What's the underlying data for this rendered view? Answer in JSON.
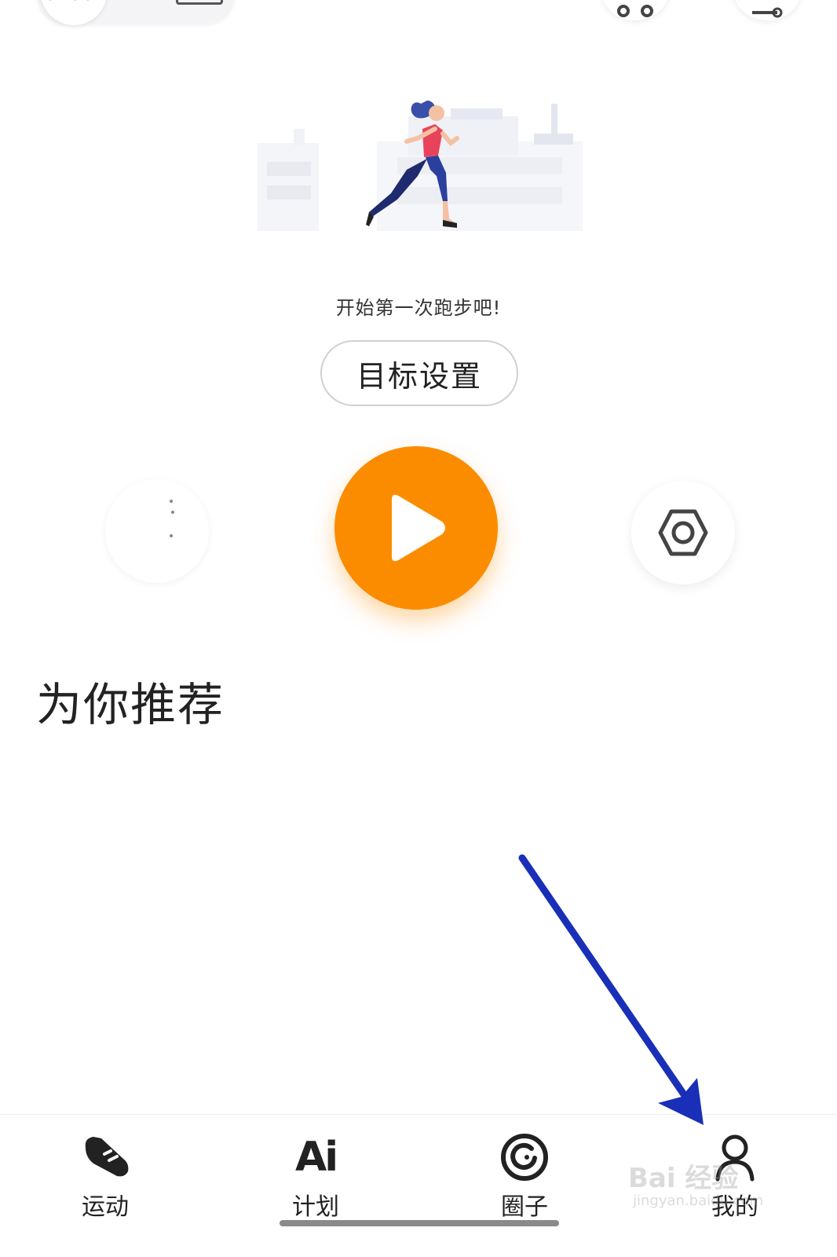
{
  "prompt": {
    "text": "开始第一次跑步吧!"
  },
  "goal_button": {
    "label": "目标设置"
  },
  "controls": {
    "play_icon": "play-icon",
    "settings_icon": "hexagon-settings-icon",
    "play_color": "#fb8c00"
  },
  "recommend": {
    "title": "为你推荐"
  },
  "bottom_nav": {
    "items": [
      {
        "label": "运动",
        "icon": "running-shoe-icon"
      },
      {
        "label": "计划",
        "icon": "ai-plan-icon",
        "icon_text": "Ai"
      },
      {
        "label": "圈子",
        "icon": "circle-community-icon"
      },
      {
        "label": "我的",
        "icon": "person-icon"
      }
    ]
  },
  "watermark": {
    "main": "Bai 经验",
    "sub": "jingyan.baidu.com"
  },
  "annotation": {
    "arrow_color": "#1a2fb8"
  }
}
